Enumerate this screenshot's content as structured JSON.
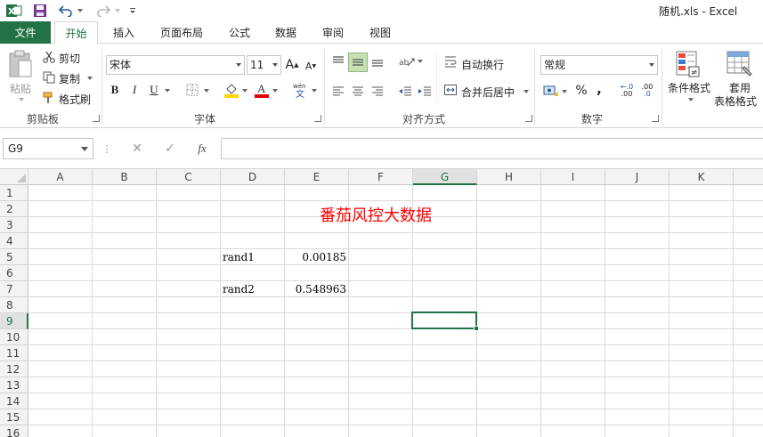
{
  "window": {
    "title": "随机.xls - Excel"
  },
  "quick_access": {
    "save_icon": "save-icon",
    "undo_icon": "undo-icon",
    "redo_icon": "redo-icon"
  },
  "tabs": [
    "文件",
    "开始",
    "插入",
    "页面布局",
    "公式",
    "数据",
    "审阅",
    "视图"
  ],
  "active_tab": "开始",
  "ribbon": {
    "clipboard": {
      "paste": "粘贴",
      "cut": "剪切",
      "copy": "复制",
      "format_painter": "格式刷",
      "label": "剪贴板"
    },
    "font": {
      "font_name": "宋体",
      "font_size": "11",
      "bold": "B",
      "italic": "I",
      "underline": "U",
      "grow": "A",
      "shrink": "A",
      "label": "字体",
      "font_color": "#e00000",
      "fill_color": "#ffd700"
    },
    "alignment": {
      "wrap_text": "自动换行",
      "merge_center": "合并后居中",
      "label": "对齐方式"
    },
    "number": {
      "format": "常规",
      "percent": "%",
      "comma": ",",
      "inc_decimal": ".00",
      "dec_decimal": ".0",
      "label": "数字"
    },
    "styles": {
      "conditional_format_label": "条件格式",
      "format_table_line1": "套用",
      "format_table_line2": "表格格式"
    }
  },
  "formula_bar": {
    "name_box": "G9",
    "cancel": "✕",
    "enter": "✓",
    "fx": "fx",
    "value": ""
  },
  "columns": [
    "A",
    "B",
    "C",
    "D",
    "E",
    "F",
    "G",
    "H",
    "I",
    "J",
    "K",
    "L"
  ],
  "rows": [
    "1",
    "2",
    "3",
    "4",
    "5",
    "6",
    "7",
    "8",
    "9",
    "10",
    "11",
    "12",
    "13",
    "14",
    "15",
    "16"
  ],
  "selected_cell": "G9",
  "cells": {
    "E2": "番茄风控大数据",
    "D5": "rand1",
    "E5": "0.00185",
    "D7": "rand2",
    "E7": "0.548963"
  },
  "colors": {
    "accent": "#217346",
    "title_text": "#ff0000"
  }
}
